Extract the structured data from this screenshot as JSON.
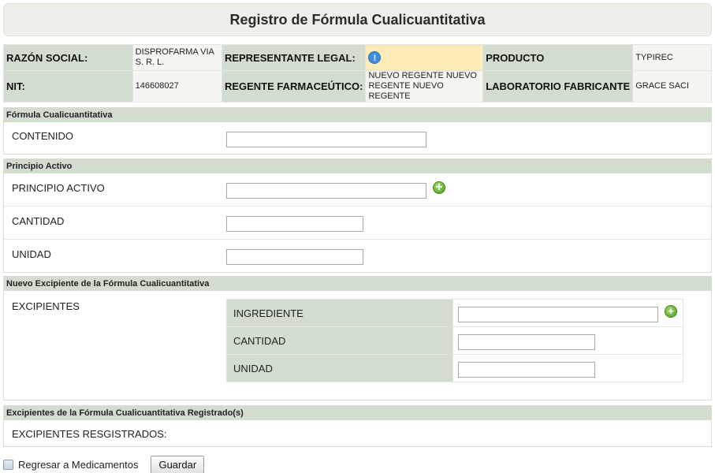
{
  "title": "Registro de Fórmula Cualicuantitativa",
  "info": {
    "razon_social_label": "RAZÓN SOCIAL:",
    "razon_social_value": "DISPROFARMA VIA S. R. L.",
    "representante_label": "REPRESENTANTE LEGAL:",
    "representante_icon": "info-icon",
    "producto_label": "PRODUCTO",
    "producto_value": "TYPIREC",
    "nit_label": "NIT:",
    "nit_value": "146608027",
    "regente_label": "REGENTE FARMACEÚTICO:",
    "regente_value": "NUEVO REGENTE NUEVO REGENTE NUEVO REGENTE",
    "laboratorio_label": "LABORATORIO FABRICANTE",
    "laboratorio_value": "GRACE SACI"
  },
  "formula": {
    "header": "Fórmula Cualicuantitativa",
    "contenido_label": "CONTENIDO",
    "contenido_value": ""
  },
  "principio": {
    "header": "Principio Activo",
    "principio_label": "PRINCIPIO ACTIVO",
    "principio_value": "",
    "cantidad_label": "CANTIDAD",
    "cantidad_value": "",
    "unidad_label": "UNIDAD",
    "unidad_value": ""
  },
  "nuevo_excipiente": {
    "header": "Nuevo Excipiente de la Fórmula Cualicuantitativa",
    "excipientes_label": "EXCIPIENTES",
    "ingrediente_label": "INGREDIENTE",
    "ingrediente_value": "",
    "cantidad_label": "CANTIDAD",
    "cantidad_value": "",
    "unidad_label": "UNIDAD",
    "unidad_value": ""
  },
  "registrados": {
    "header": "Excipientes de la Fórmula Cualicuantitativa Registrado(s)",
    "label": "EXCIPIENTES RESGISTRADOS:"
  },
  "footer": {
    "regresar_label": "Regresar a Medicamentos",
    "guardar_label": "Guardar"
  },
  "colors": {
    "header_bg": "#d2ddd0",
    "warning_bg": "#fdebb7",
    "add_icon": "#4e9e1f",
    "info_icon": "#3d8de0"
  }
}
